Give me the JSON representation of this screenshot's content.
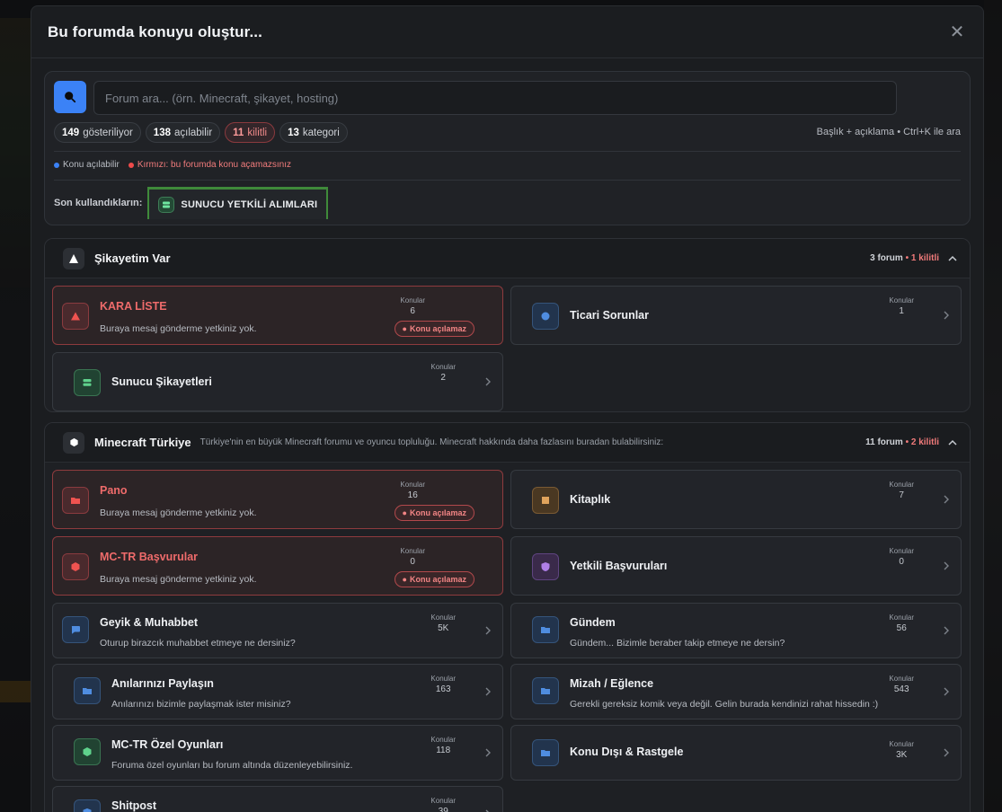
{
  "modal": {
    "title": "Bu forumda konuyu oluştur...",
    "close_symbol": "✕"
  },
  "search": {
    "placeholder": "Forum ara... (örn. Minecraft, şikayet, hosting)",
    "hint": "Başlık + açıklama • Ctrl+K ile ara",
    "chips": [
      {
        "count": "149",
        "label": "gösteriliyor"
      },
      {
        "count": "138",
        "label": "açılabilir"
      },
      {
        "count": "11",
        "label": "kilitli"
      },
      {
        "count": "13",
        "label": "kategori"
      }
    ],
    "legend": {
      "open": "Konu açılabilir",
      "locked": "Kırmızı: bu forumda konu açamazsınız"
    },
    "recent_label": "Son kullandıkların:",
    "recent_item": "SUNUCU YETKİLİ ALIMLARI"
  },
  "colors": {
    "accent": "#3b82f6",
    "locked": "#ef6b6b",
    "recent_border": "#3f8a3a"
  },
  "common": {
    "topics_label": "Konular",
    "locked_badge": "Konu açılamaz",
    "no_permission": "Buraya mesaj gönderme yetkiniz yok."
  },
  "sections": [
    {
      "title": "Şikayetim Var",
      "description": "",
      "forum_count": "3 forum",
      "locked_count": "• 1 kilitli",
      "icon": "warning-triangle-icon",
      "forums": [
        {
          "title": "KARA LİSTE",
          "desc": "Buraya mesaj gönderme yetkiniz yok.",
          "topics": "6",
          "locked": true,
          "icon": "alert-triangle-icon"
        },
        {
          "title": "Ticari Sorunlar",
          "desc": "",
          "topics": "1",
          "locked": false,
          "icon": "circle-icon"
        },
        {
          "title": "Sunucu Şikayetleri",
          "desc": "",
          "topics": "2",
          "locked": false,
          "icon": "server-icon"
        }
      ]
    },
    {
      "title": "Minecraft Türkiye",
      "description": "Türkiye'nin en büyük Minecraft forumu ve oyuncu topluluğu. Minecraft hakkında daha fazlasını buradan bulabilirsiniz:",
      "forum_count": "11 forum",
      "locked_count": "• 2 kilitli",
      "icon": "cube-icon",
      "forums": [
        {
          "title": "Pano",
          "desc": "Buraya mesaj gönderme yetkiniz yok.",
          "topics": "16",
          "locked": true,
          "icon": "folder-icon"
        },
        {
          "title": "Kitaplık",
          "desc": "",
          "topics": "7",
          "locked": false,
          "icon": "book-icon"
        },
        {
          "title": "MC-TR Başvurular",
          "desc": "Buraya mesaj gönderme yetkiniz yok.",
          "topics": "0",
          "locked": true,
          "icon": "hexagon-icon"
        },
        {
          "title": "Yetkili Başvuruları",
          "desc": "",
          "topics": "0",
          "locked": false,
          "icon": "shield-icon"
        },
        {
          "title": "Geyik & Muhabbet",
          "desc": "Oturup birazcık muhabbet etmeye ne dersiniz?",
          "topics": "5K",
          "locked": false,
          "icon": "chat-bubble-icon"
        },
        {
          "title": "Gündem",
          "desc": "Gündem... Bizimle beraber takip etmeye ne dersin?",
          "topics": "56",
          "locked": false,
          "icon": "folder-icon"
        },
        {
          "title": "Anılarınızı Paylaşın",
          "desc": "Anılarınızı bizimle paylaşmak ister misiniz?",
          "topics": "163",
          "locked": false,
          "icon": "folder-icon"
        },
        {
          "title": "Mizah / Eğlence",
          "desc": "Gerekli gereksiz komik veya değil. Gelin burada kendinizi rahat hissedin :)",
          "topics": "543",
          "locked": false,
          "icon": "folder-icon"
        },
        {
          "title": "MC-TR Özel Oyunları",
          "desc": "Foruma özel oyunları bu forum altında düzenleyebilirsiniz.",
          "topics": "118",
          "locked": false,
          "icon": "hexagon-icon"
        },
        {
          "title": "Konu Dışı & Rastgele",
          "desc": "",
          "topics": "3K",
          "locked": false,
          "icon": "folder-icon"
        },
        {
          "title": "Shitpost",
          "desc": "",
          "topics": "39",
          "locked": false,
          "icon": "shield-icon"
        }
      ]
    }
  ]
}
